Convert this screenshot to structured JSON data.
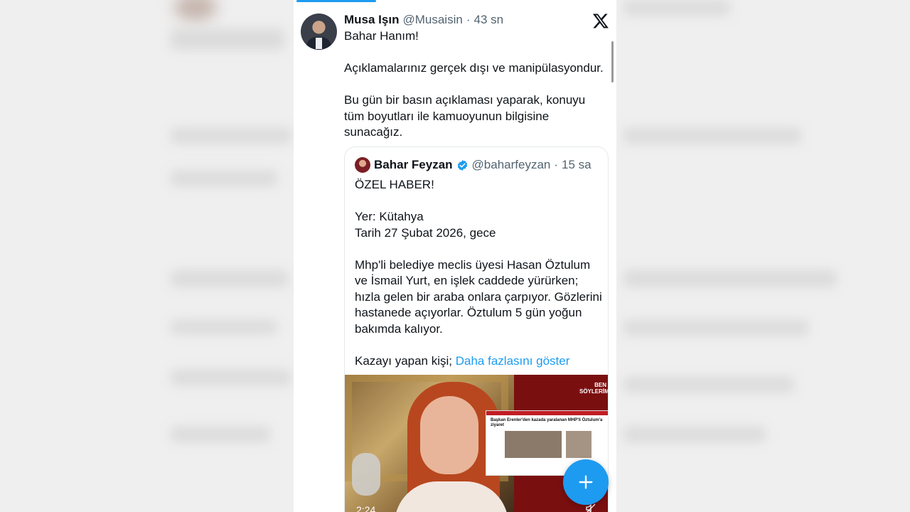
{
  "tweet": {
    "author_name": "Musa Işın",
    "author_handle": "@Musaisin",
    "separator": "·",
    "time": "43 sn",
    "paragraphs": [
      "Bahar Hanım!",
      "Açıklamalarınız gerçek dışı  ve manipülasyondur.",
      "Bu gün bir basın açıklaması yaparak, konuyu tüm boyutları ile kamuoyunun bilgisine sunacağız."
    ]
  },
  "quoted_tweet": {
    "author_name": "Bahar Feyzan",
    "author_handle": "@baharfeyzan",
    "separator": "·",
    "time": "15 sa",
    "paragraphs": [
      "ÖZEL HABER!",
      "Yer: Kütahya\nTarih 27 Şubat 2026, gece",
      "Mhp'li belediye meclis üyesi Hasan Öztulum ve İsmail Yurt, en işlek caddede yürürken; hızla gelen bir araba onlara çarpıyor. Gözlerini hastanede açıyorlar. Öztulum 5 gün yoğun bakımda kalıyor."
    ],
    "last_line_prefix": "Kazayı yapan kişi; ",
    "show_more": "Daha fazlasını göster",
    "media": {
      "duration": "2:24",
      "logo_text": "BEN SÖYLERİM!",
      "article_headline": "Başkan Erenler'den kazada yaralanan MHP'li Öztulum'a ziyaret"
    }
  },
  "icons": {
    "close": "x-logo-icon",
    "verified": "verified-badge-icon",
    "compose": "plus-icon",
    "mute": "mute-icon"
  },
  "colors": {
    "accent": "#1d9bf0",
    "text": "#0f1419",
    "secondary": "#536471"
  }
}
